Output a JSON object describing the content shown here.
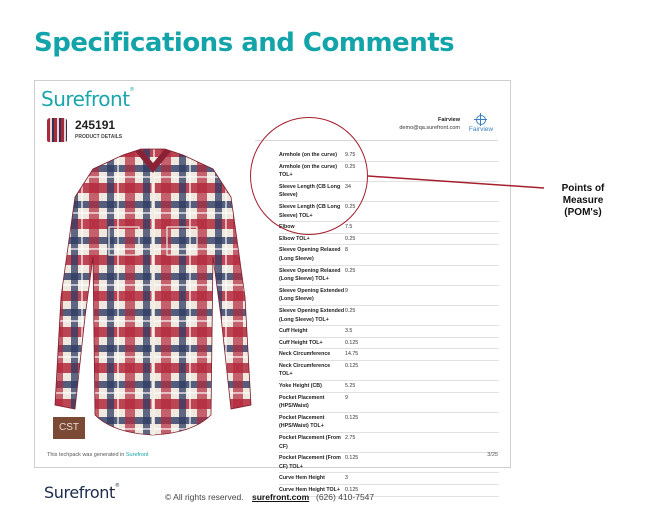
{
  "slide": {
    "title": "Specifications and Comments"
  },
  "page": {
    "brand": "Surefront",
    "trademark": "®",
    "style_number": "245191",
    "section_label": "PRODUCT DETAILS",
    "company_name": "Fairview",
    "company_email": "demo@qa.surefront.com",
    "company_logo_text": "Fairview",
    "badge": "CST",
    "footer_note_prefix": "This techpack was generated in ",
    "footer_note_brand": "Surefront",
    "page_number": "3/25"
  },
  "pom_rows": [
    {
      "name": "Armhole (on the curve)",
      "value": "9.75"
    },
    {
      "name": "Armhole (on the curve) TOL+",
      "value": "0.25"
    },
    {
      "name": "Sleeve Length (CB Long Sleeve)",
      "value": "34"
    },
    {
      "name": "Sleeve Length (CB Long Sleeve) TOL+",
      "value": "0.25"
    },
    {
      "name": "Elbow",
      "value": "7.5"
    },
    {
      "name": "Elbow TOL+",
      "value": "0.25"
    },
    {
      "name": "Sleeve Opening Relaxed (Long Sleeve)",
      "value": "8"
    },
    {
      "name": "Sleeve Opening Relaxed (Long Sleeve) TOL+",
      "value": "0.25"
    },
    {
      "name": "Sleeve Opening Extended (Long Sleeve)",
      "value": "9"
    },
    {
      "name": "Sleeve Opening Extended (Long Sleeve) TOL+",
      "value": "0.25"
    },
    {
      "name": "Cuff Height",
      "value": "3.5"
    },
    {
      "name": "Cuff Height TOL+",
      "value": "0.125"
    },
    {
      "name": "Neck Circumference",
      "value": "14.75"
    },
    {
      "name": "Neck Circumference TOL+",
      "value": "0.125"
    },
    {
      "name": "Yoke Height (CB)",
      "value": "5.25"
    },
    {
      "name": "Pocket Placement (HPS/Waist)",
      "value": "9"
    },
    {
      "name": "Pocket Placement (HPS/Waist) TOL+",
      "value": "0.125"
    },
    {
      "name": "Pocket Placement (From CF)",
      "value": "2.75"
    },
    {
      "name": "Pocket Placement (From CF) TOL+",
      "value": "0.125"
    },
    {
      "name": "Curve Hem Height",
      "value": "3"
    },
    {
      "name": "Curve Hem Height TOL+",
      "value": "0.125"
    }
  ],
  "callout": {
    "label": "Points of Measure (POM's)"
  },
  "footer": {
    "brand": "Surefront",
    "trademark": "®",
    "copyright": "© All rights reserved.",
    "link_text": "surefront.com",
    "phone": "(626) 410-7547"
  },
  "colors": {
    "accent": "#13a4a9",
    "highlight": "#a51f2e",
    "footer_brand": "#1b2a4a"
  }
}
